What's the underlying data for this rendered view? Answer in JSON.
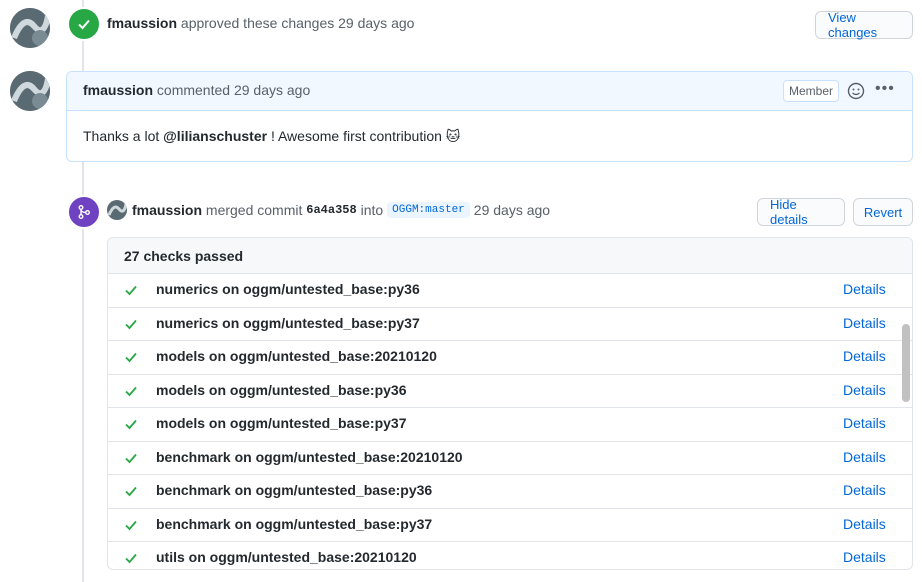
{
  "approval": {
    "user": "fmaussion",
    "text": "approved these changes",
    "time": "29 days ago",
    "button": "View changes"
  },
  "comment": {
    "user": "fmaussion",
    "action": "commented",
    "time": "29 days ago",
    "role_badge": "Member",
    "body_prefix": "Thanks a lot",
    "mention": "@lilianschuster",
    "body_suffix": "! Awesome first contribution",
    "emoji": "🐱"
  },
  "merge": {
    "user": "fmaussion",
    "action": "merged commit",
    "sha": "6a4a358",
    "into": "into",
    "branch": "OGGM:master",
    "time": "29 days ago",
    "hide_details_label": "Hide details",
    "revert_label": "Revert"
  },
  "checks": {
    "summary": "27 checks passed",
    "details_label": "Details",
    "items": [
      {
        "name": "numerics on oggm/untested_base:py36"
      },
      {
        "name": "numerics on oggm/untested_base:py37"
      },
      {
        "name": "models on oggm/untested_base:20210120"
      },
      {
        "name": "models on oggm/untested_base:py36"
      },
      {
        "name": "models on oggm/untested_base:py37"
      },
      {
        "name": "benchmark on oggm/untested_base:20210120"
      },
      {
        "name": "benchmark on oggm/untested_base:py36"
      },
      {
        "name": "benchmark on oggm/untested_base:py37"
      },
      {
        "name": "utils on oggm/untested_base:20210120"
      }
    ]
  },
  "colors": {
    "success": "#28a745",
    "merged": "#6f42c1",
    "link": "#0366d6"
  }
}
